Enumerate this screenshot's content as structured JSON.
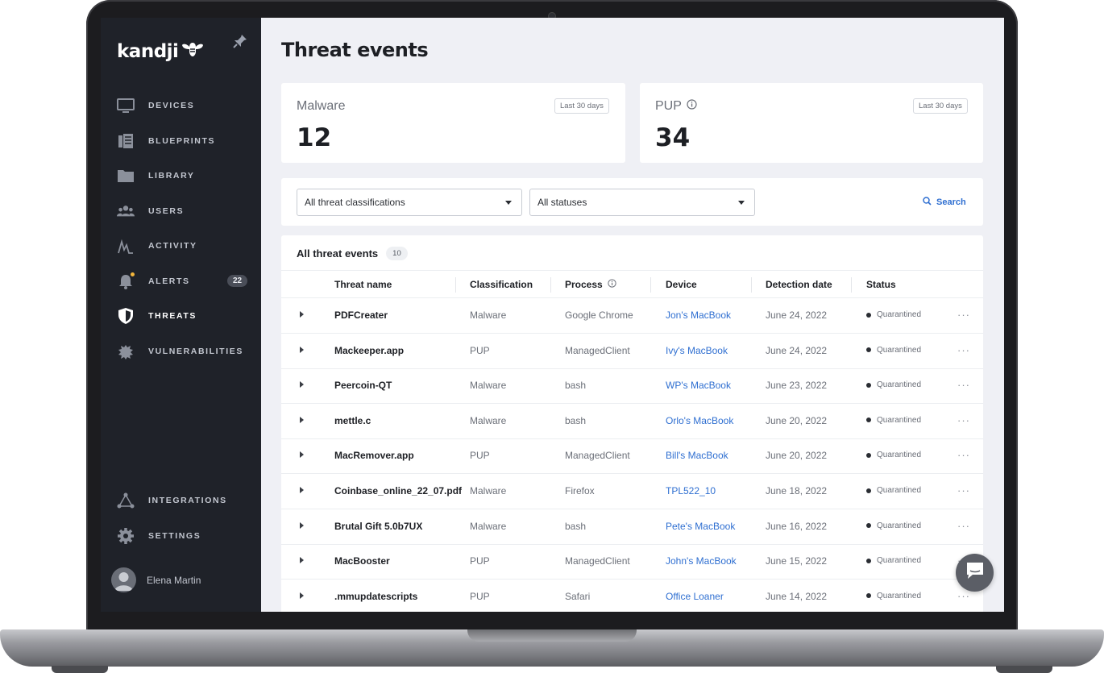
{
  "app": {
    "logo_text": "kandji",
    "user_name": "Elena Martin"
  },
  "sidebar": {
    "items": [
      {
        "label": "DEVICES",
        "icon": "monitor-icon"
      },
      {
        "label": "BLUEPRINTS",
        "icon": "blueprints-icon"
      },
      {
        "label": "LIBRARY",
        "icon": "folder-icon"
      },
      {
        "label": "USERS",
        "icon": "users-icon"
      },
      {
        "label": "ACTIVITY",
        "icon": "activity-icon"
      },
      {
        "label": "ALERTS",
        "icon": "bell-icon",
        "badge": "22"
      },
      {
        "label": "THREATS",
        "icon": "shield-icon",
        "active": true
      },
      {
        "label": "VULNERABILITIES",
        "icon": "bug-icon"
      }
    ],
    "bottom_items": [
      {
        "label": "INTEGRATIONS",
        "icon": "integrations-icon"
      },
      {
        "label": "SETTINGS",
        "icon": "gear-icon"
      }
    ]
  },
  "page": {
    "title": "Threat events"
  },
  "stats": {
    "malware": {
      "label": "Malware",
      "value": "12",
      "period": "Last 30 days"
    },
    "pup": {
      "label": "PUP",
      "value": "34",
      "period": "Last 30 days"
    }
  },
  "filters": {
    "classification": "All threat classifications",
    "status": "All statuses",
    "search_label": "Search"
  },
  "table": {
    "title": "All threat events",
    "count": "10",
    "columns": [
      "Threat name",
      "Classification",
      "Process",
      "Device",
      "Detection date",
      "Status"
    ],
    "rows": [
      {
        "name": "PDFCreater",
        "classification": "Malware",
        "process": "Google Chrome",
        "device": "Jon's MacBook",
        "date": "June 24, 2022",
        "status": "Quarantined"
      },
      {
        "name": "Mackeeper.app",
        "classification": "PUP",
        "process": "ManagedClient",
        "device": "Ivy's MacBook",
        "date": "June 24, 2022",
        "status": "Quarantined"
      },
      {
        "name": "Peercoin-QT",
        "classification": "Malware",
        "process": "bash",
        "device": "WP's MacBook",
        "date": "June 23, 2022",
        "status": "Quarantined"
      },
      {
        "name": "mettle.c",
        "classification": "Malware",
        "process": "bash",
        "device": "Orlo's MacBook",
        "date": "June 20, 2022",
        "status": "Quarantined"
      },
      {
        "name": "MacRemover.app",
        "classification": "PUP",
        "process": "ManagedClient",
        "device": "Bill's MacBook",
        "date": "June 20, 2022",
        "status": "Quarantined"
      },
      {
        "name": "Coinbase_online_22_07.pdf",
        "classification": "Malware",
        "process": "Firefox",
        "device": "TPL522_10",
        "date": "June 18, 2022",
        "status": "Quarantined"
      },
      {
        "name": "Brutal Gift 5.0b7UX",
        "classification": "Malware",
        "process": "bash",
        "device": "Pete's MacBook",
        "date": "June 16, 2022",
        "status": "Quarantined"
      },
      {
        "name": "MacBooster",
        "classification": "PUP",
        "process": "ManagedClient",
        "device": "John's MacBook",
        "date": "June 15, 2022",
        "status": "Quarantined"
      },
      {
        "name": ".mmupdatescripts",
        "classification": "PUP",
        "process": "Safari",
        "device": "Office Loaner",
        "date": "June 14, 2022",
        "status": "Quarantined"
      }
    ]
  },
  "colors": {
    "sidebar_bg": "#1f2229",
    "accent_link": "#2f6fd1",
    "page_bg": "#eff0f5",
    "alert_dot": "#f3b63b"
  }
}
